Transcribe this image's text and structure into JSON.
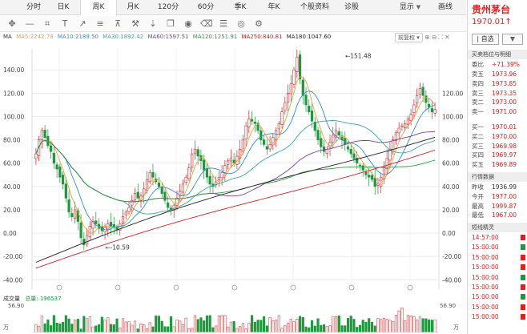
{
  "tabs": [
    {
      "label": "分时",
      "active": false
    },
    {
      "label": "日K",
      "active": false
    },
    {
      "label": "周K",
      "active": true
    },
    {
      "label": "月K",
      "active": false
    },
    {
      "label": "120分",
      "active": false
    },
    {
      "label": "60分",
      "active": false
    },
    {
      "label": "季K",
      "active": false
    },
    {
      "label": "年K",
      "active": false
    },
    {
      "label": "个股资料",
      "active": false
    },
    {
      "label": "诊股",
      "active": false
    },
    {
      "label": "显示",
      "active": false
    },
    {
      "label": "画线",
      "active": false
    }
  ],
  "toolbar_icons": [
    "move-icon",
    "line-icon",
    "crop-icon",
    "text-tool-icon",
    "arrow-icon",
    "ruler-icon",
    "pin-icon",
    "hammer-icon",
    "down-arrow-icon",
    "copy-icon",
    "eye-icon",
    "trash-icon",
    "menu-icon",
    "eye-alt-icon",
    "gear-icon"
  ],
  "ma_header": {
    "label": "MA",
    "items": [
      {
        "text": "MA5:2242.78",
        "color": "#e8a23a"
      },
      {
        "text": "MA10:2189.50",
        "color": "#2f8fd0"
      },
      {
        "text": "MA30:1892.42",
        "color": "#3aa89a"
      },
      {
        "text": "MA60:1597.51",
        "color": "#7a3fa0"
      },
      {
        "text": "MA120:1251.91",
        "color": "#2a9e3a"
      },
      {
        "text": "MA250:840.81",
        "color": "#d02020"
      },
      {
        "text": "MA180:1047.60",
        "color": "#222222"
      }
    ],
    "adjust_label": "前复权"
  },
  "chart_data": {
    "type": "candlestick",
    "y_axis_ticks": [
      "140.00",
      "120.00",
      "100.00",
      "80.00",
      "60.00",
      "40.00",
      "20.00",
      "0.00",
      "-20.00",
      "-40.00"
    ],
    "right_axis_ticks": [
      "120.00",
      "100.00",
      "80.00",
      "60.00",
      "40.00",
      "20.00",
      "0.00",
      "-20.00",
      "-40.00"
    ],
    "ylim": [
      -48,
      158
    ],
    "annotations": [
      {
        "text": "151.48",
        "x_index": 102,
        "y": 151.48,
        "kind": "high"
      },
      {
        "text": "-10.59",
        "x_index": 22,
        "y": -10.59,
        "kind": "low"
      }
    ],
    "closes": [
      68,
      80,
      88,
      82,
      75,
      70,
      60,
      55,
      48,
      42,
      30,
      18,
      14,
      20,
      10,
      -4,
      -10,
      -2,
      6,
      10,
      8,
      4,
      2,
      5,
      8,
      6,
      5,
      3,
      8,
      14,
      18,
      22,
      28,
      34,
      30,
      32,
      38,
      46,
      52,
      48,
      44,
      40,
      34,
      28,
      22,
      20,
      24,
      30,
      36,
      42,
      48,
      56,
      68,
      72,
      66,
      62,
      54,
      48,
      42,
      40,
      44,
      48,
      52,
      58,
      62,
      64,
      60,
      66,
      72,
      80,
      92,
      98,
      96,
      94,
      88,
      80,
      76,
      72,
      76,
      82,
      88,
      94,
      104,
      112,
      120,
      128,
      140,
      151,
      132,
      118,
      110,
      104,
      96,
      88,
      80,
      74,
      70,
      72,
      78,
      84,
      88,
      84,
      80,
      76,
      72,
      68,
      64,
      60,
      58,
      54,
      50,
      48,
      46,
      40,
      42,
      48,
      56,
      64,
      72,
      80,
      86,
      90,
      92,
      94,
      98,
      102,
      110,
      118,
      124,
      118,
      112,
      108,
      104,
      106
    ]
  },
  "volume": {
    "header_label": "成交量",
    "total_label": "总量: 196537",
    "axis_max": "56.90",
    "axis_max_right": "56.90",
    "unit_left": "万",
    "unit_right": "万"
  },
  "right_panel": {
    "stock_name": "贵州茅台",
    "price": "1970.01",
    "price_arrow": "↑",
    "add_button": "| 自选",
    "dropdown": "▼",
    "section_orderbook": "买卖档位与明细",
    "ratio": {
      "label": "委比",
      "value": "+71.39%"
    },
    "asks": [
      {
        "label": "卖五",
        "value": "1973.96"
      },
      {
        "label": "卖四",
        "value": "1973.85"
      },
      {
        "label": "卖三",
        "value": "1973.35"
      },
      {
        "label": "卖二",
        "value": "1973.00"
      },
      {
        "label": "卖一",
        "value": "1971.00"
      }
    ],
    "bids": [
      {
        "label": "买一",
        "value": "1970.01"
      },
      {
        "label": "买二",
        "value": "1970.00"
      },
      {
        "label": "买三",
        "value": "1969.98"
      },
      {
        "label": "买四",
        "value": "1969.97"
      },
      {
        "label": "买五",
        "value": "1969.89"
      }
    ],
    "section_market": "行情数据",
    "market": [
      {
        "label": "昨收",
        "value": "1936.99",
        "color": "dark"
      },
      {
        "label": "今开",
        "value": "1977.00",
        "color": "red"
      },
      {
        "label": "最高",
        "value": "1999.87",
        "color": "red"
      },
      {
        "label": "最低",
        "value": "1967.00",
        "color": "red"
      }
    ],
    "section_ticks": "短线精灵",
    "ticks": [
      {
        "time": "14:57:00",
        "mark": "#e02020"
      },
      {
        "time": "15:00:00",
        "mark": "#1a9a3a"
      },
      {
        "time": "15:00:00",
        "mark": "#e02020"
      },
      {
        "time": "15:00:00",
        "mark": "#e02020"
      },
      {
        "time": "15:00:00",
        "mark": "#1a9a3a"
      },
      {
        "time": "15:00:00",
        "mark": "#e02020"
      },
      {
        "time": "15:00:00",
        "mark": "#1a9a3a"
      },
      {
        "time": "15:00:00",
        "mark": "#e02020"
      },
      {
        "time": "15:00:00",
        "mark": "#e02020"
      }
    ]
  }
}
